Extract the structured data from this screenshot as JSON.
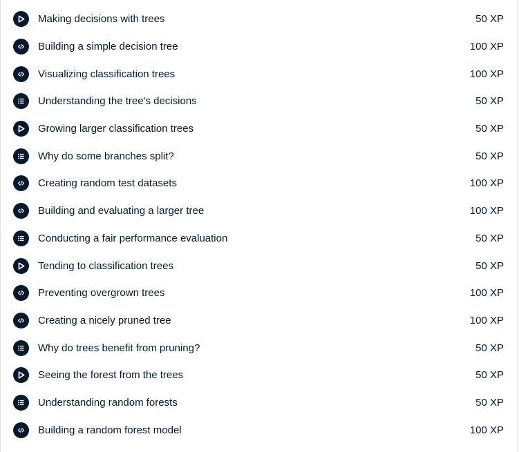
{
  "exercises": [
    {
      "icon": "video-icon",
      "title": "Making decisions with trees",
      "xp": "50 XP"
    },
    {
      "icon": "code-icon",
      "title": "Building a simple decision tree",
      "xp": "100 XP"
    },
    {
      "icon": "code-icon",
      "title": "Visualizing classification trees",
      "xp": "100 XP"
    },
    {
      "icon": "list-icon",
      "title": "Understanding the tree's decisions",
      "xp": "50 XP"
    },
    {
      "icon": "video-icon",
      "title": "Growing larger classification trees",
      "xp": "50 XP"
    },
    {
      "icon": "list-icon",
      "title": "Why do some branches split?",
      "xp": "50 XP"
    },
    {
      "icon": "code-icon",
      "title": "Creating random test datasets",
      "xp": "100 XP"
    },
    {
      "icon": "code-icon",
      "title": "Building and evaluating a larger tree",
      "xp": "100 XP"
    },
    {
      "icon": "list-icon",
      "title": "Conducting a fair performance evaluation",
      "xp": "50 XP"
    },
    {
      "icon": "video-icon",
      "title": "Tending to classification trees",
      "xp": "50 XP"
    },
    {
      "icon": "code-icon",
      "title": "Preventing overgrown trees",
      "xp": "100 XP"
    },
    {
      "icon": "code-icon",
      "title": "Creating a nicely pruned tree",
      "xp": "100 XP"
    },
    {
      "icon": "list-icon",
      "title": "Why do trees benefit from pruning?",
      "xp": "50 XP"
    },
    {
      "icon": "video-icon",
      "title": "Seeing the forest from the trees",
      "xp": "50 XP"
    },
    {
      "icon": "list-icon",
      "title": "Understanding random forests",
      "xp": "50 XP"
    },
    {
      "icon": "code-icon",
      "title": "Building a random forest model",
      "xp": "100 XP"
    }
  ],
  "colors": {
    "text": "#05192d",
    "icon_bg": "#05192d",
    "icon_fg": "#ffffff",
    "border": "#e5e5e5"
  }
}
